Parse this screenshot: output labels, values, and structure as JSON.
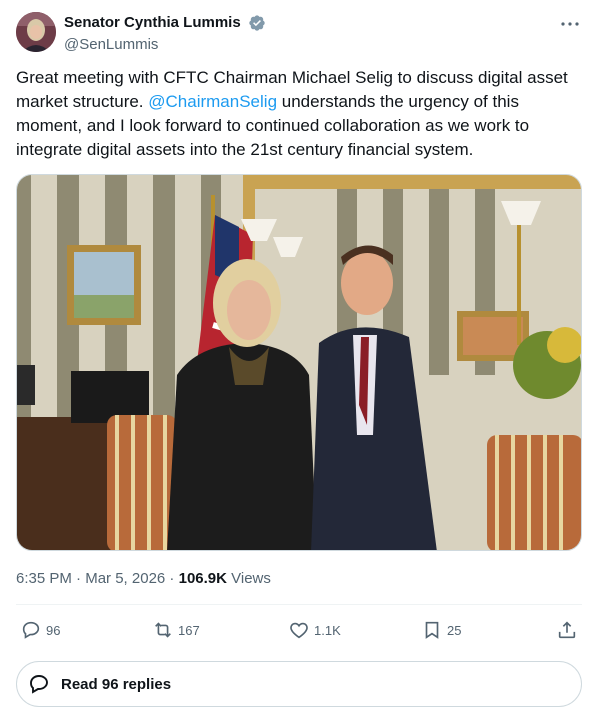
{
  "author": {
    "display_name": "Senator Cynthia Lummis",
    "handle": "@SenLummis",
    "verified_icon": "verified-badge-icon",
    "avatar_icon": "profile-avatar"
  },
  "tweet": {
    "text_before_mention": "Great meeting with CFTC Chairman Michael Selig to discuss digital asset market structure. ",
    "mention": "@ChairmanSelig",
    "text_after_mention": " understands the urgency of this moment, and I look forward to continued collaboration as we work to integrate digital assets into the 21st century financial system.",
    "time": "6:35 PM",
    "separator": " · ",
    "date": "Mar 5, 2026",
    "separator2": " · ",
    "views_count": "106.9K",
    "views_label": " Views"
  },
  "actions": {
    "replies": "96",
    "reposts": "167",
    "likes": "1.1K",
    "bookmarks": "25"
  },
  "read_replies_label": "Read 96 replies",
  "colors": {
    "link": "#1d9bf0",
    "secondary_text": "#536471",
    "border": "#cfd9de"
  }
}
